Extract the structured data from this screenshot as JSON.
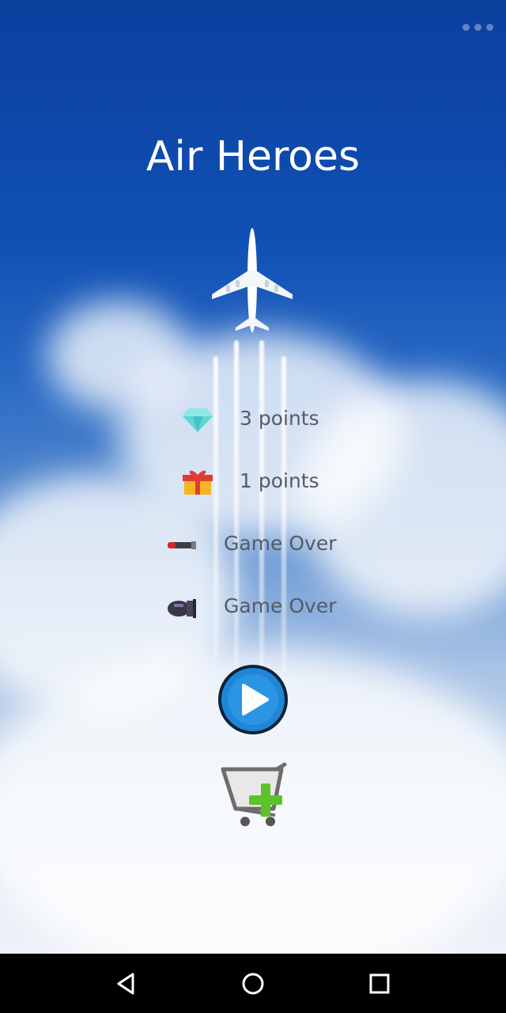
{
  "app": {
    "title": "Air Heroes"
  },
  "legend": [
    {
      "icon": "diamond-icon",
      "text": "3 points"
    },
    {
      "icon": "gift-icon",
      "text": "1 points"
    },
    {
      "icon": "missile-icon",
      "text": "Game Over"
    },
    {
      "icon": "bomb-icon",
      "text": "Game Over"
    }
  ],
  "buttons": {
    "play": "play-icon",
    "shop": "cart-add-icon"
  },
  "navbar": {
    "back": "back-triangle-icon",
    "home": "home-circle-icon",
    "recents": "recents-square-icon"
  },
  "colors": {
    "sky_top": "#0b3f9e",
    "play_blue": "#1f86d6",
    "plus_green": "#5ec22a"
  }
}
